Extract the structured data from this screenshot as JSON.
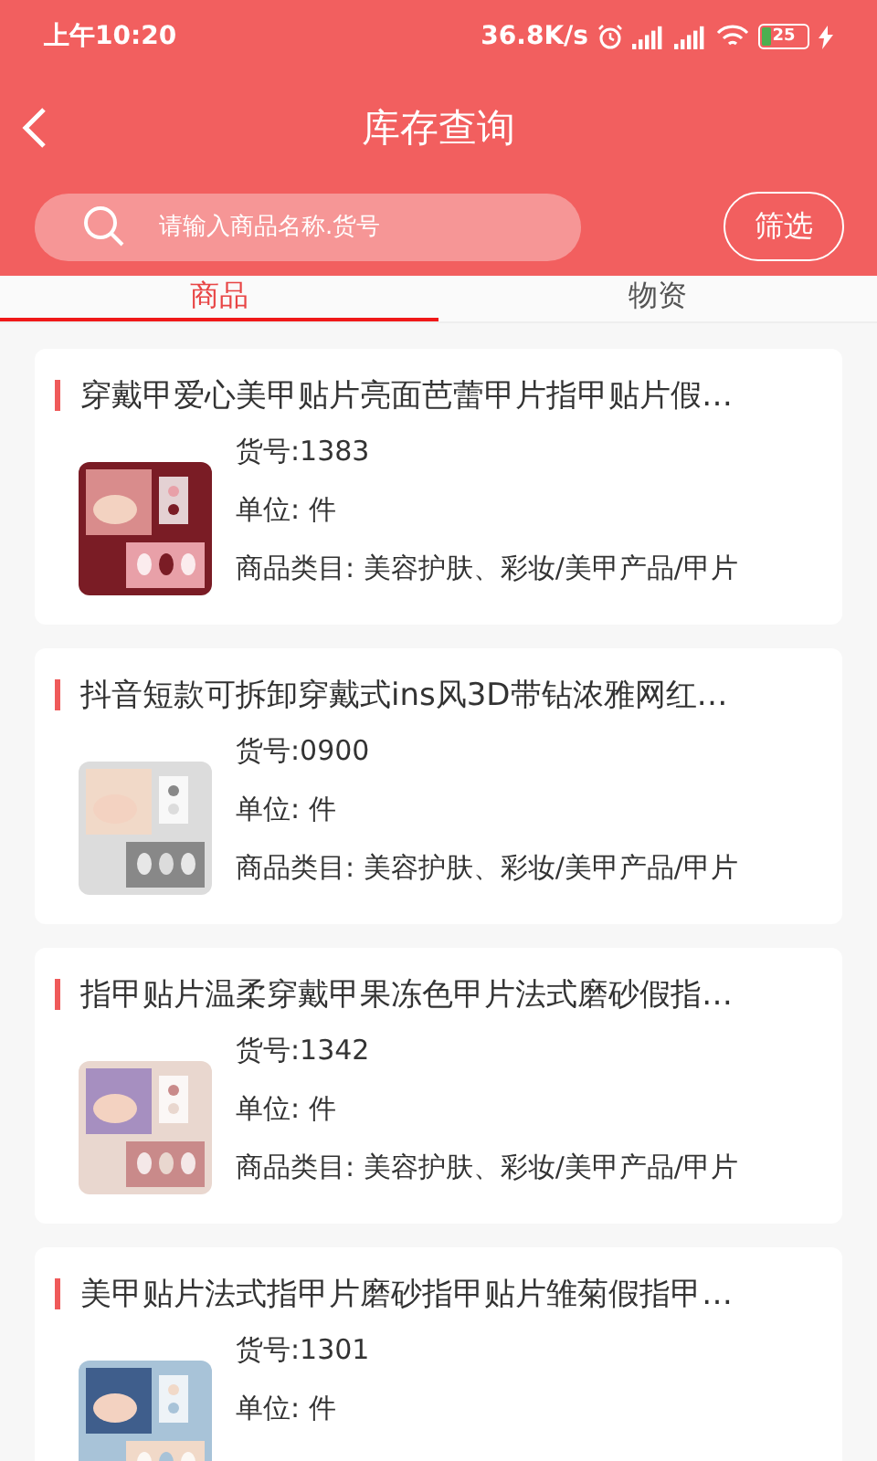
{
  "status_bar": {
    "time": "上午10:20",
    "speed": "36.8K/s",
    "battery": "25"
  },
  "header": {
    "title": "库存查询"
  },
  "search": {
    "placeholder": "请输入商品名称.货号"
  },
  "filter_button": "筛选",
  "tabs": [
    {
      "label": "商品",
      "selected": true
    },
    {
      "label": "物资",
      "selected": false
    }
  ],
  "products": [
    {
      "title": "穿戴甲爱心美甲贴片亮面芭蕾甲片指甲贴片假…",
      "code": "货号:1383",
      "unit": "单位: 件",
      "category": "商品类目: 美容护肤、彩妆/美甲产品/甲片"
    },
    {
      "title": "抖音短款可拆卸穿戴式ins风3D带钻浓雅网红…",
      "code": "货号:0900",
      "unit": "单位: 件",
      "category": "商品类目: 美容护肤、彩妆/美甲产品/甲片"
    },
    {
      "title": "指甲贴片温柔穿戴甲果冻色甲片法式磨砂假指…",
      "code": "货号:1342",
      "unit": "单位: 件",
      "category": "商品类目: 美容护肤、彩妆/美甲产品/甲片"
    },
    {
      "title": "美甲贴片法式指甲片磨砂指甲贴片雏菊假指甲…",
      "code": "货号:1301",
      "unit": "单位: 件"
    }
  ]
}
